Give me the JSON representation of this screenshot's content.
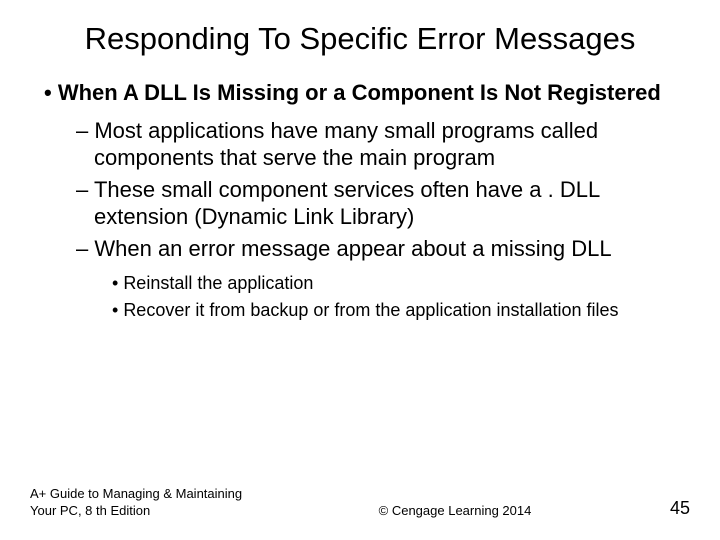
{
  "title": "Responding To Specific Error Messages",
  "bullets": {
    "l1": "When A DLL Is Missing or a Component Is Not Registered",
    "l2a": "Most applications have many small programs called components that serve the main program",
    "l2b": "These small component services often have a . DLL extension (Dynamic Link Library)",
    "l2c": "When an error message appear about a missing DLL",
    "l3a": "Reinstall the application",
    "l3b": "Recover it from backup or from the application installation files"
  },
  "footer": {
    "left": "A+ Guide to Managing & Maintaining Your PC, 8 th Edition",
    "center": "© Cengage Learning  2014",
    "right": "45"
  }
}
